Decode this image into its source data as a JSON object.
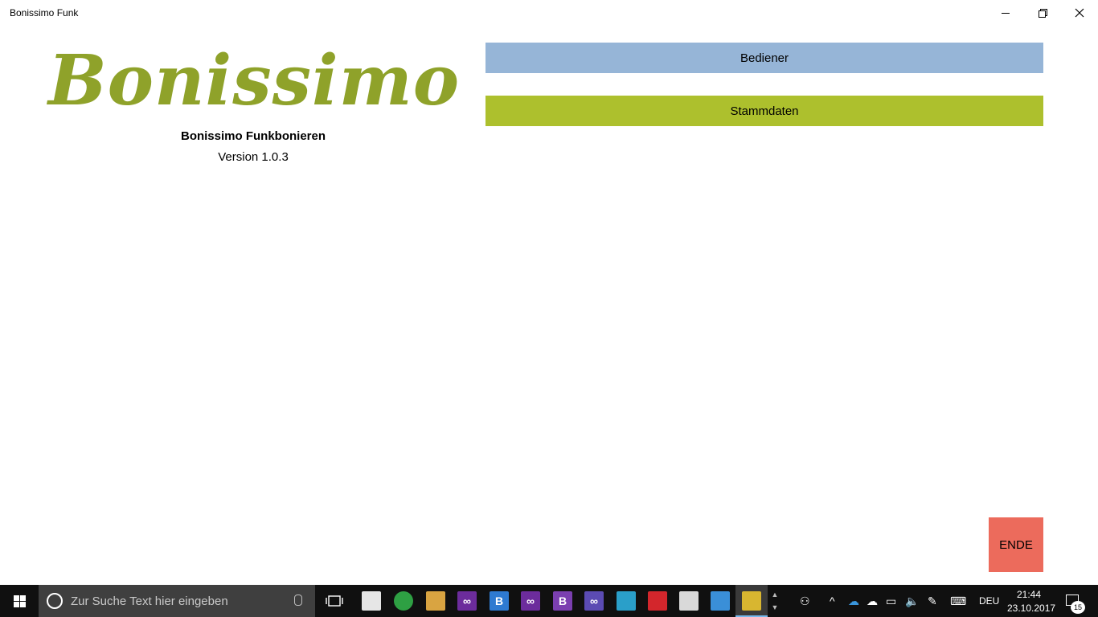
{
  "window": {
    "title": "Bonissimo Funk"
  },
  "branding": {
    "logo_text": "Bonissimo",
    "app_name": "Bonissimo Funkbonieren",
    "version": "Version 1.0.3"
  },
  "buttons": {
    "bediener": "Bediener",
    "stammdaten": "Stammdaten",
    "ende": "ENDE"
  },
  "taskbar": {
    "search_placeholder": "Zur Suche Text hier eingeben",
    "language": "DEU",
    "time": "21:44",
    "date": "23.10.2017",
    "notification_count": "15"
  },
  "colors": {
    "bediener_bg": "#96b5d7",
    "stammdaten_bg": "#adc02d",
    "ende_bg": "#ec6b5c",
    "logo": "#8fa22a"
  }
}
